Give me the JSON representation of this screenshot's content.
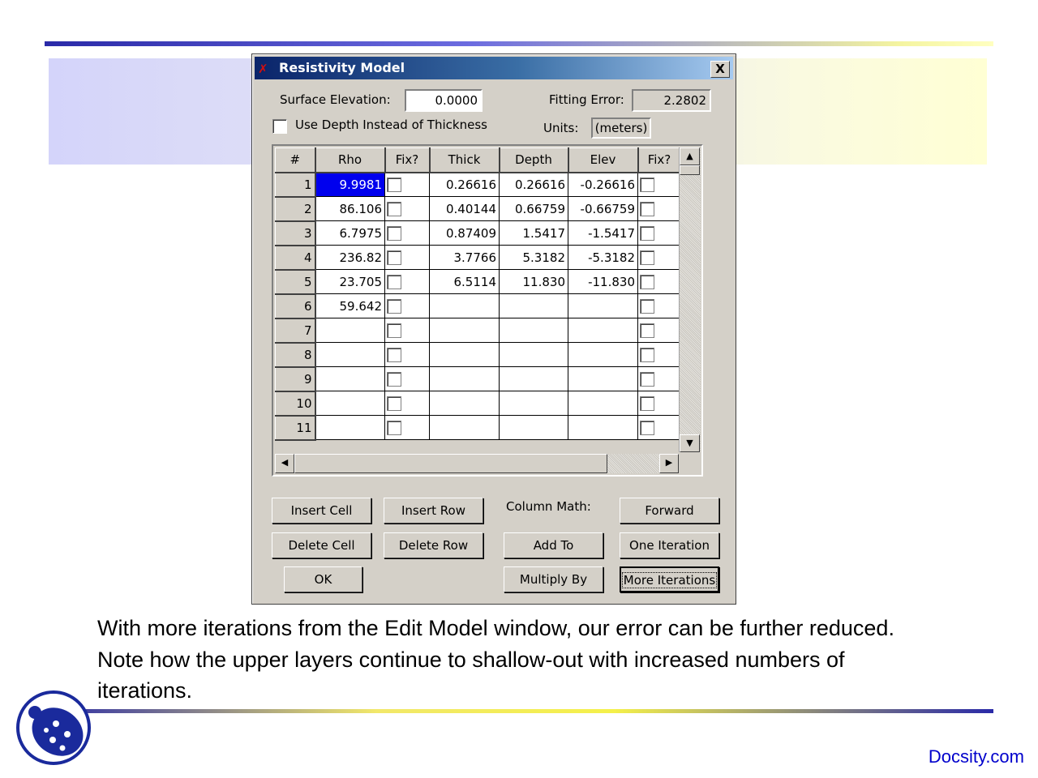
{
  "dialog": {
    "title": "Resistivity Model",
    "close_label": "X",
    "surface_elevation_label": "Surface Elevation:",
    "surface_elevation_value": "0.0000",
    "fitting_error_label": "Fitting Error:",
    "fitting_error_value": "2.2802",
    "use_depth_label": "Use Depth Instead of Thickness",
    "use_depth_checked": false,
    "units_label": "Units:",
    "units_value": "(meters)"
  },
  "grid": {
    "headers": [
      "#",
      "Rho",
      "Fix?",
      "Thick",
      "Depth",
      "Elev",
      "Fix?"
    ],
    "rows": [
      {
        "n": "1",
        "rho": "9.9981",
        "thick": "0.26616",
        "depth": "0.26616",
        "elev": "-0.26616"
      },
      {
        "n": "2",
        "rho": "86.106",
        "thick": "0.40144",
        "depth": "0.66759",
        "elev": "-0.66759"
      },
      {
        "n": "3",
        "rho": "6.7975",
        "thick": "0.87409",
        "depth": "1.5417",
        "elev": "-1.5417"
      },
      {
        "n": "4",
        "rho": "236.82",
        "thick": "3.7766",
        "depth": "5.3182",
        "elev": "-5.3182"
      },
      {
        "n": "5",
        "rho": "23.705",
        "thick": "6.5114",
        "depth": "11.830",
        "elev": "-11.830"
      },
      {
        "n": "6",
        "rho": "59.642",
        "thick": "",
        "depth": "",
        "elev": ""
      },
      {
        "n": "7",
        "rho": "",
        "thick": "",
        "depth": "",
        "elev": ""
      },
      {
        "n": "8",
        "rho": "",
        "thick": "",
        "depth": "",
        "elev": ""
      },
      {
        "n": "9",
        "rho": "",
        "thick": "",
        "depth": "",
        "elev": ""
      },
      {
        "n": "10",
        "rho": "",
        "thick": "",
        "depth": "",
        "elev": ""
      },
      {
        "n": "11",
        "rho": "",
        "thick": "",
        "depth": "",
        "elev": ""
      }
    ],
    "scroll_up_icon": "triangle-up",
    "scroll_down_icon": "triangle-down",
    "scroll_left_icon": "triangle-left",
    "scroll_right_icon": "triangle-right"
  },
  "buttons": {
    "insert_cell": "Insert Cell",
    "insert_row": "Insert Row",
    "column_math_label": "Column Math:",
    "forward": "Forward",
    "delete_cell": "Delete Cell",
    "delete_row": "Delete Row",
    "add_to": "Add To",
    "one_iteration": "One Iteration",
    "ok": "OK",
    "multiply_by": "Multiply By",
    "more_iterations": "More Iterations"
  },
  "slide": {
    "caption": "With more iterations from the Edit Model window, our error can be further reduced. Note how the upper layers continue to shallow-out with increased numbers of iterations.",
    "brand": "Docsity.com",
    "logo_icon": "ladybug-logo-icon"
  }
}
